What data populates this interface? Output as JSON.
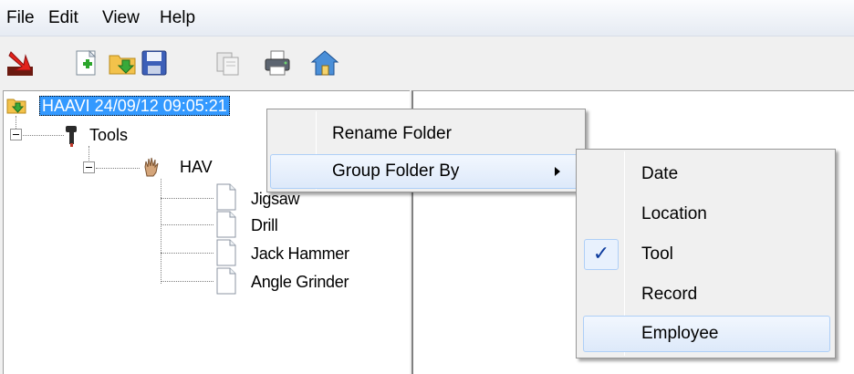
{
  "menubar": {
    "items": [
      "File",
      "Edit",
      "View",
      "Help"
    ]
  },
  "toolbar": {
    "buttons": [
      "exit-icon",
      "new-folder-icon",
      "open-folder-icon",
      "save-icon",
      "copy-icon",
      "print-icon",
      "home-icon"
    ]
  },
  "tree": {
    "root": "HAAVI 24/09/12 09:05:21",
    "tools": "Tools",
    "hav": "HAV",
    "items": [
      "Jigsaw",
      "Drill",
      "Jack Hammer",
      "Angle Grinder"
    ]
  },
  "context_menu": {
    "rename": "Rename Folder",
    "group_by": "Group Folder By"
  },
  "submenu": {
    "items": [
      "Date",
      "Location",
      "Tool",
      "Record",
      "Employee"
    ],
    "checked": "Tool",
    "hovered": "Employee"
  },
  "colors": {
    "selection": "#3399ff",
    "check": "#0c3b9d",
    "highlight_border": "#aecff7"
  }
}
